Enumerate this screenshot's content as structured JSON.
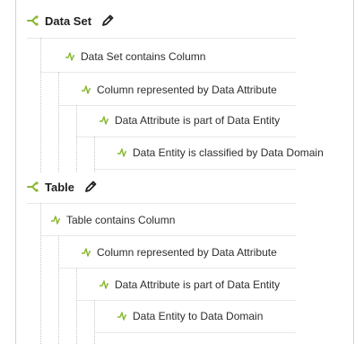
{
  "colors": {
    "accent": "#8ab833",
    "text": "#2d2d2d"
  },
  "groups": [
    {
      "title": "Data Set",
      "root_icon": "branch-icon",
      "edit_icon": "pencil-icon",
      "children": [
        "Data Set contains Column",
        "Column represented by Data Attribute",
        "Data Attribute is part of Data Entity",
        "Data Entity is classified by Data Domain"
      ]
    },
    {
      "title": "Table",
      "root_icon": "branch-icon",
      "edit_icon": "pencil-icon",
      "children": [
        "Table contains Column",
        "Column represented by Data Attribute",
        "Data Attribute is part of Data Entity",
        "Data Entity to Data Domain"
      ]
    }
  ]
}
